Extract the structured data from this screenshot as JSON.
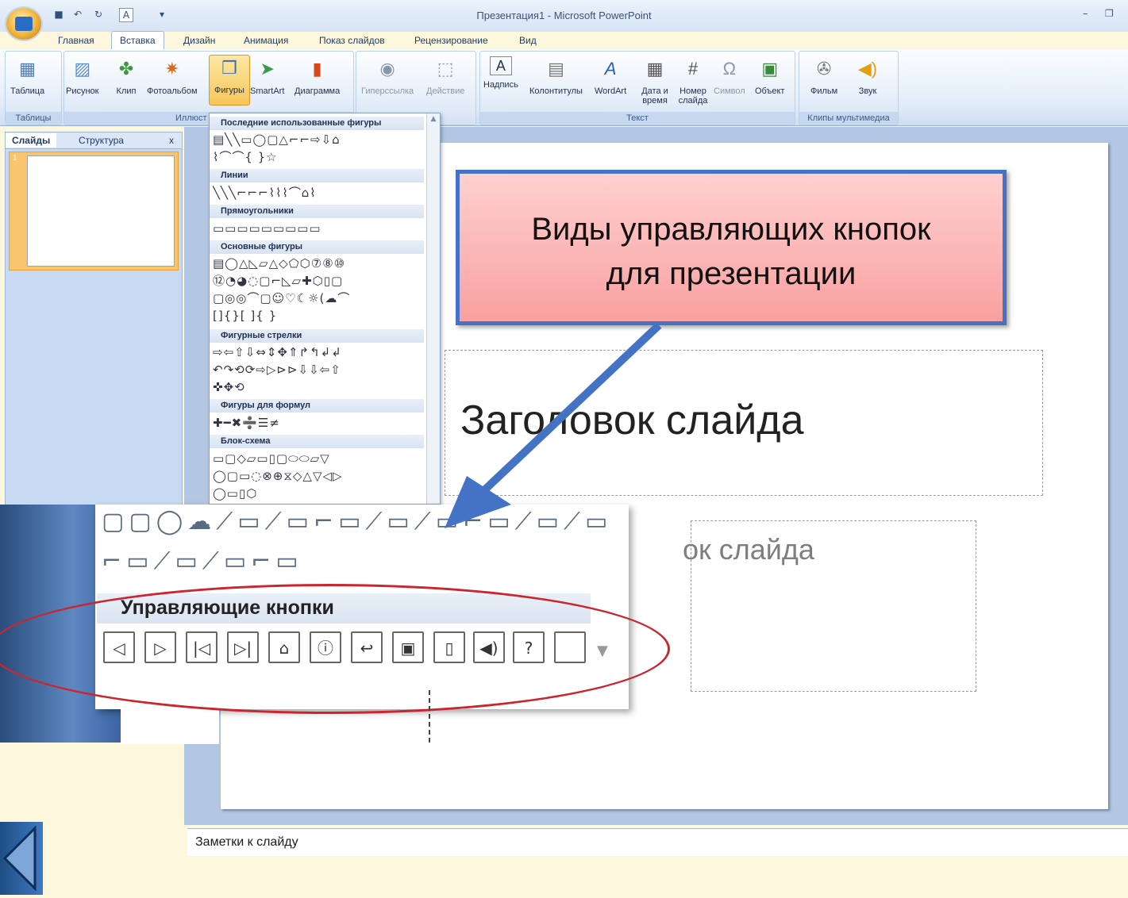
{
  "window": {
    "title": "Презентация1 - Microsoft PowerPoint",
    "qat_icons": [
      "save-icon",
      "undo-icon",
      "redo-icon",
      "font-size-icon",
      "customize-icon"
    ]
  },
  "tabs": [
    "Главная",
    "Вставка",
    "Дизайн",
    "Анимация",
    "Показ слайдов",
    "Рецензирование",
    "Вид"
  ],
  "ribbon": {
    "groups": {
      "tables": "Таблицы",
      "illustrations": "Иллюст",
      "text": "Текст",
      "media": "Клипы мультимедиа"
    },
    "buttons": {
      "table": "Таблица",
      "picture": "Рисунок",
      "clip": "Клип",
      "album": "Фотоальбом",
      "shapes": "Фигуры",
      "smartart": "SmartArt",
      "chart": "Диаграмма",
      "hyperlink": "Гиперссылка",
      "action": "Действие",
      "textbox": "Надпись",
      "header": "Колонтитулы",
      "wordart": "WordArt",
      "datetime": "Дата и время",
      "slidenum": "Номер слайда",
      "symbol": "Символ",
      "object": "Объект",
      "movie": "Фильм",
      "sound": "Звук"
    }
  },
  "left_pane": {
    "tab_slides": "Слайды",
    "tab_outline": "Структура",
    "close": "x",
    "slide_number": "1"
  },
  "gallery": {
    "sections": [
      "Последние использованные фигуры",
      "Линии",
      "Прямоугольники",
      "Основные фигуры",
      "Фигурные стрелки",
      "Фигуры для формул",
      "Блок-схема"
    ],
    "rows": {
      "recent": [
        "▤╲╲▭◯▢△⌐⌐⇨⇩⌂",
        "⌇⌒⌒{ }☆"
      ],
      "lines": [
        "╲╲╲⌐⌐⌐⌇⌇⌇⌒⌂⌇"
      ],
      "rects": [
        "▭▭▭▭▭▭▭▭▭"
      ],
      "basic": [
        "▤◯△◺▱△◇⬠⬡⑦⑧⑩",
        "⑫◔◕◌▢⌐◺▱✚⬡▯▢",
        "▢◎◎⌒▢☺♡☾☼(☁⌒",
        "[]{}[ ]{ }"
      ],
      "arrows": [
        "⇨⇦⇧⇩⇔⇕✥⇑↱↰↲↲",
        "↶↷⟲⟳⇨▷⊳⊳⇩⇩⇦⇧",
        "✜✥⟲"
      ],
      "formulas": [
        "✚━✖➗☰≠"
      ],
      "flow": [
        "▭▢◇▱▭▯▢⬭⬭▱▽",
        "◯▢▭◌⊗⊕⧖◇△▽◁▷",
        "◯▭▯⬡"
      ]
    }
  },
  "slide": {
    "title": "Заголовок слайда",
    "subtitle": "ок слайда"
  },
  "notes": "Заметки к слайду",
  "callout": {
    "line1": "Виды управляющих кнопок",
    "line2": "для презентации"
  },
  "zoom": {
    "title": "Управляющие кнопки",
    "callouts_row1": "▢▢◯☁⟋▭⟋▭⌐▭⟋▭⟋▭⌐▭⟋▭⟋▭",
    "callouts_row2": "⌐▭⟋▭⟋▭⌐▭",
    "action_buttons": [
      "◁",
      "▷",
      "|◁",
      "▷|",
      "⌂",
      "ⓘ",
      "↩",
      "▣",
      "▯",
      "◀)",
      "?",
      ""
    ],
    "action_icons": [
      "back-icon",
      "forward-icon",
      "beginning-icon",
      "end-icon",
      "home-icon",
      "information-icon",
      "return-icon",
      "movie-icon",
      "document-icon",
      "sound-icon",
      "help-icon",
      "custom-icon"
    ]
  },
  "colors": {
    "accent": "#4472c4",
    "callout_fill": "#f9a0a0",
    "ellipse": "#c9262f",
    "ribbon": "#dbe7f7"
  }
}
